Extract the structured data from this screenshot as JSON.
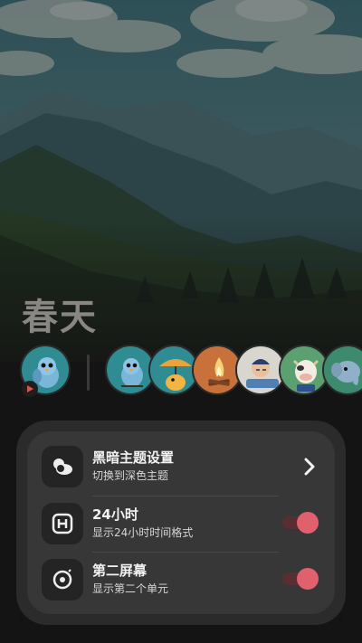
{
  "season": {
    "title": "春天"
  },
  "avatars": [
    {
      "icon": "blue-bird-icon"
    },
    {
      "icon": "blue-bird-icon"
    },
    {
      "icon": "duck-umbrella-icon"
    },
    {
      "icon": "campfire-icon"
    },
    {
      "icon": "sleeping-man-icon"
    },
    {
      "icon": "cow-icon"
    },
    {
      "icon": "elephant-icon"
    }
  ],
  "settings": {
    "items": [
      {
        "title": "黑暗主题设置",
        "subtitle": "切换到深色主题",
        "icon": "weather-cloud-icon",
        "control": "chevron"
      },
      {
        "title": "24小时",
        "subtitle": "显示24小时时间格式",
        "icon": "h-box-icon",
        "control": "toggle",
        "on": true
      },
      {
        "title": "第二屏幕",
        "subtitle": "显示第二个单元",
        "icon": "disc-icon",
        "control": "toggle",
        "on": true
      }
    ]
  },
  "colors": {
    "accent": "#e0606d",
    "panel": "#373737",
    "background": "#1b1b1b"
  }
}
